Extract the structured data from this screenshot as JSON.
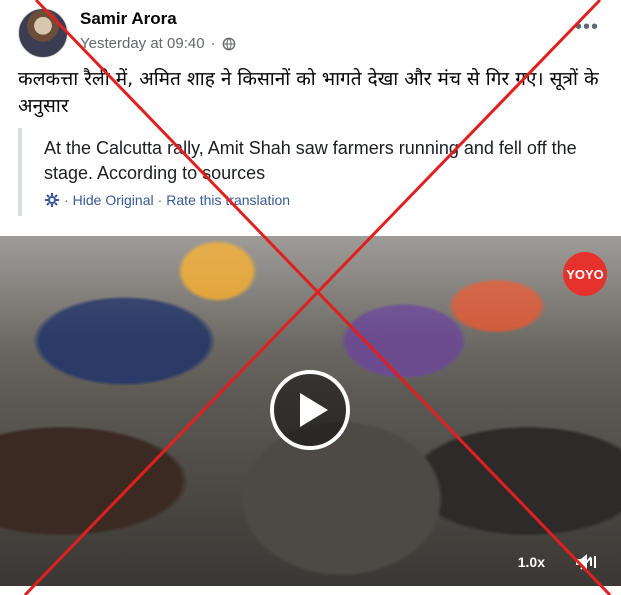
{
  "post": {
    "author": "Samir Arora",
    "timestamp": "Yesterday at 09:40",
    "privacy_icon": "globe-icon",
    "more_icon": "more-options-icon",
    "text": "कलकत्ता रैली में, अमित शाह ने किसानों को भागते देखा और मंच से गिर गए।  सूत्रों के अनुसार",
    "translation": "At the Calcutta rally, Amit Shah saw farmers running and fell off the stage. According to sources",
    "hide_original": "Hide Original",
    "separator": "·",
    "rate_translation": "Rate this translation",
    "settings_icon": "gear-icon"
  },
  "video": {
    "logo_text": "YOYO",
    "speed": "1.0x",
    "play_icon": "play-icon",
    "mute_icon": "speaker-muted-icon"
  },
  "overlay": {
    "cross_color": "#e0201f"
  },
  "colors": {
    "link": "#385898",
    "meta": "#65676b"
  }
}
